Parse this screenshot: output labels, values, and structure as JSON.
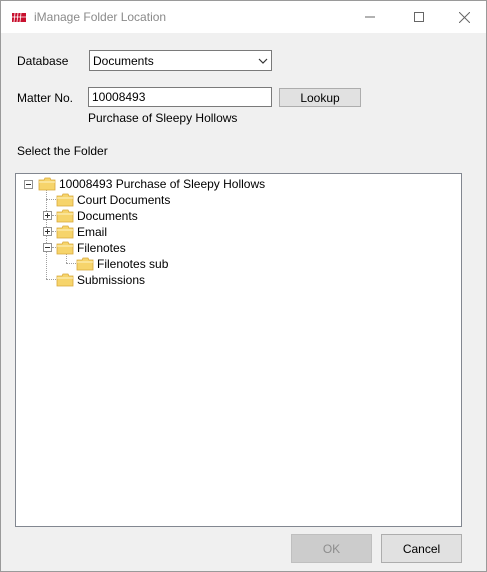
{
  "window": {
    "title": "iManage Folder Location"
  },
  "database": {
    "label": "Database",
    "value": "Documents"
  },
  "matter": {
    "label": "Matter No.",
    "value": "10008493",
    "description": "Purchase of Sleepy Hollows",
    "lookup_label": "Lookup"
  },
  "folder_section": {
    "label": "Select the Folder"
  },
  "tree": {
    "root": "10008493 Purchase of Sleepy Hollows",
    "children": [
      "Court Documents",
      "Documents",
      "Email",
      "Filenotes",
      "Filenotes sub",
      "Submissions"
    ]
  },
  "buttons": {
    "ok": "OK",
    "cancel": "Cancel"
  },
  "colors": {
    "folder": "#f6d46b",
    "folder_dark": "#d9a93a",
    "icon_red": "#c8102e"
  }
}
